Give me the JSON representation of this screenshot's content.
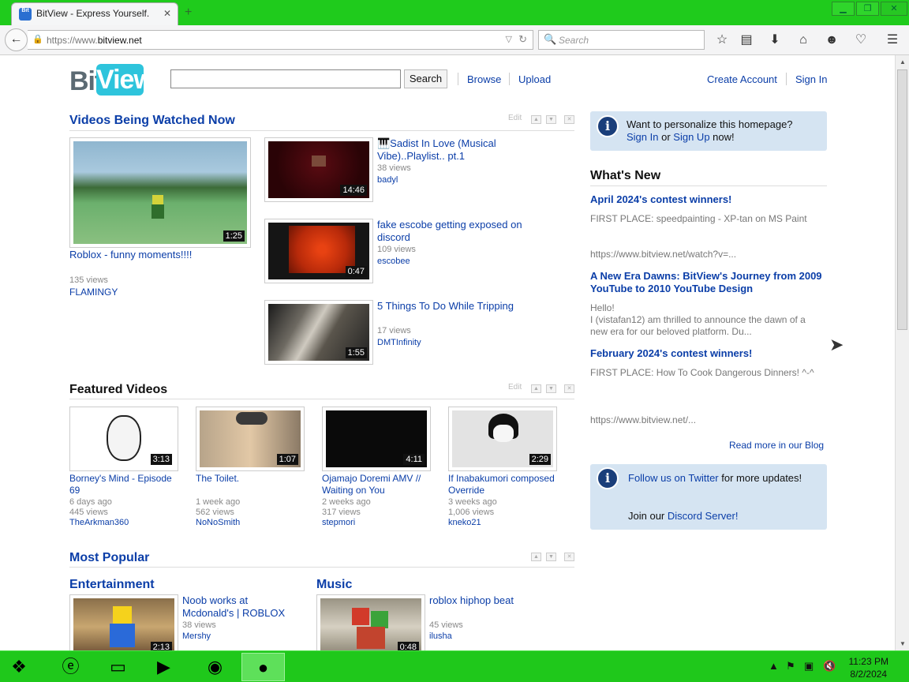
{
  "browser": {
    "tab_title": "BitView - Express Yourself.",
    "favicon_text": "Bit",
    "url_prefix": "https://www.",
    "url_domain": "bitview.net",
    "search_placeholder": "Search"
  },
  "header": {
    "logo_bit": "Bit",
    "logo_view": "View",
    "search_button": "Search",
    "nav": [
      "Browse",
      "Upload"
    ],
    "account": [
      "Create Account",
      "Sign In"
    ]
  },
  "watched_now": {
    "title": "Videos Being Watched Now",
    "edit": "Edit",
    "main": {
      "title": "Roblox - funny moments!!!!",
      "views": "135 views",
      "user": "FLAMINGY",
      "duration": "1:25"
    },
    "items": [
      {
        "title": "🎹Sadist In Love (Musical Vibe)..Playlist.. pt.1",
        "views": "38 views",
        "user": "badyl",
        "duration": "14:46"
      },
      {
        "title": "fake escobe getting exposed on discord",
        "views": "109 views",
        "user": "escobee",
        "duration": "0:47"
      },
      {
        "title": "5 Things To Do While Tripping",
        "views": "17 views",
        "user": "DMTInfinity",
        "duration": "1:55"
      }
    ]
  },
  "featured": {
    "title": "Featured Videos",
    "edit": "Edit",
    "items": [
      {
        "title": "Borney's Mind - Episode 69",
        "age": "6 days ago",
        "views": "445 views",
        "user": "TheArkman360",
        "duration": "3:13"
      },
      {
        "title": "The Toilet.",
        "age": "1 week ago",
        "views": "562 views",
        "user": "NoNoSmith",
        "duration": "1:07"
      },
      {
        "title": "Ojamajo Doremi AMV // Waiting on You",
        "age": "2 weeks ago",
        "views": "317 views",
        "user": "stepmori",
        "duration": "4:11"
      },
      {
        "title": "If Inabakumori composed Override",
        "age": "3 weeks ago",
        "views": "1,006 views",
        "user": "kneko21",
        "duration": "2:29"
      }
    ]
  },
  "popular": {
    "title": "Most Popular",
    "categories": [
      {
        "name": "Entertainment",
        "video": {
          "title": "Noob works at Mcdonald's | ROBLOX",
          "views": "38 views",
          "user": "Mershy",
          "duration": "2:13"
        }
      },
      {
        "name": "Music",
        "video": {
          "title": "roblox hiphop beat",
          "views": "45 views",
          "user": "ilusha",
          "duration": "0:48"
        }
      }
    ]
  },
  "sidebar": {
    "personalize": {
      "q": "Want to personalize this homepage?",
      "sign_in": "Sign In",
      "or": "or",
      "sign_up": "Sign Up",
      "now": "now!"
    },
    "whats_new_title": "What's New",
    "news": [
      {
        "title": "April 2024's contest winners!",
        "body": "FIRST PLACE: speedpainting - XP-tan on MS Paint",
        "link": "https://www.bitview.net/watch?v=..."
      },
      {
        "title": "A New Era Dawns: BitView's Journey from 2009 YouTube to 2010 YouTube Design",
        "body": "Hello!\nI (vistafan12) am thrilled to announce the dawn of a new era for our beloved platform. Du..."
      },
      {
        "title": "February 2024's contest winners!",
        "body": "FIRST PLACE: How To Cook Dangerous Dinners! ^-^",
        "link": "https://www.bitview.net/..."
      }
    ],
    "read_more": "Read more in our Blog",
    "social": {
      "twitter": "Follow us on Twitter",
      "twitter_rest": "for more updates!",
      "discord_pre": "Join our",
      "discord": "Discord Server!"
    }
  },
  "taskbar": {
    "time": "11:23 PM",
    "date": "8/2/2024"
  },
  "colors": {
    "link": "#0b3ea8",
    "chrome_green": "#1fcb1c",
    "infobox": "#d5e4f2"
  }
}
